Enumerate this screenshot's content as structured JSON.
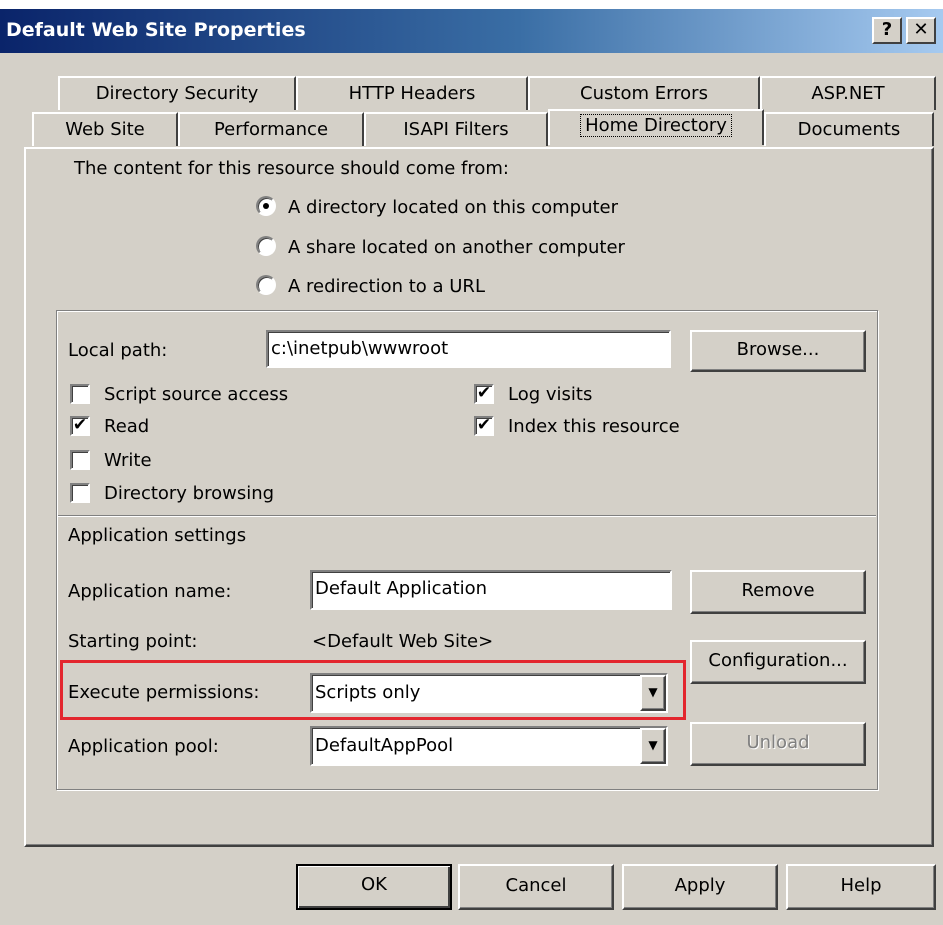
{
  "window": {
    "title": "Default Web Site Properties",
    "help_glyph": "?",
    "close_glyph": "✕"
  },
  "tabs_row1": [
    "Directory Security",
    "HTTP Headers",
    "Custom Errors",
    "ASP.NET"
  ],
  "tabs_row2": [
    "Web Site",
    "Performance",
    "ISAPI Filters",
    "Home Directory",
    "Documents"
  ],
  "active_tab": "Home Directory",
  "content_source": {
    "heading": "The content for this resource should come from:",
    "options": [
      {
        "label": "A directory located on this computer",
        "selected": true
      },
      {
        "label": "A share located on another computer",
        "selected": false
      },
      {
        "label": "A redirection to a URL",
        "selected": false
      }
    ]
  },
  "local_path": {
    "label": "Local path:",
    "value": "c:\\inetpub\\wwwroot",
    "browse_label": "Browse..."
  },
  "checkboxes": [
    {
      "label": "Script source access",
      "checked": false
    },
    {
      "label": "Read",
      "checked": true
    },
    {
      "label": "Write",
      "checked": false
    },
    {
      "label": "Directory browsing",
      "checked": false
    },
    {
      "label": "Log visits",
      "checked": true
    },
    {
      "label": "Index this resource",
      "checked": true
    }
  ],
  "app_settings": {
    "heading": "Application settings",
    "name_label": "Application name:",
    "name_value": "Default Application",
    "remove_label": "Remove",
    "starting_point_label": "Starting point:",
    "starting_point_value": "<Default Web Site>",
    "configuration_label": "Configuration...",
    "execute_label": "Execute permissions:",
    "execute_value": "Scripts only",
    "pool_label": "Application pool:",
    "pool_value": "DefaultAppPool",
    "unload_label": "Unload"
  },
  "footer_buttons": {
    "ok": "OK",
    "cancel": "Cancel",
    "apply": "Apply",
    "help": "Help"
  },
  "colors": {
    "titlebar_start": "#0a246a",
    "titlebar_end": "#a6caf0",
    "dialog_face": "#d4d0c8",
    "highlight_box": "#e3262e"
  },
  "icons": {
    "dropdown_arrow": "▼",
    "checkmark": "✔"
  }
}
